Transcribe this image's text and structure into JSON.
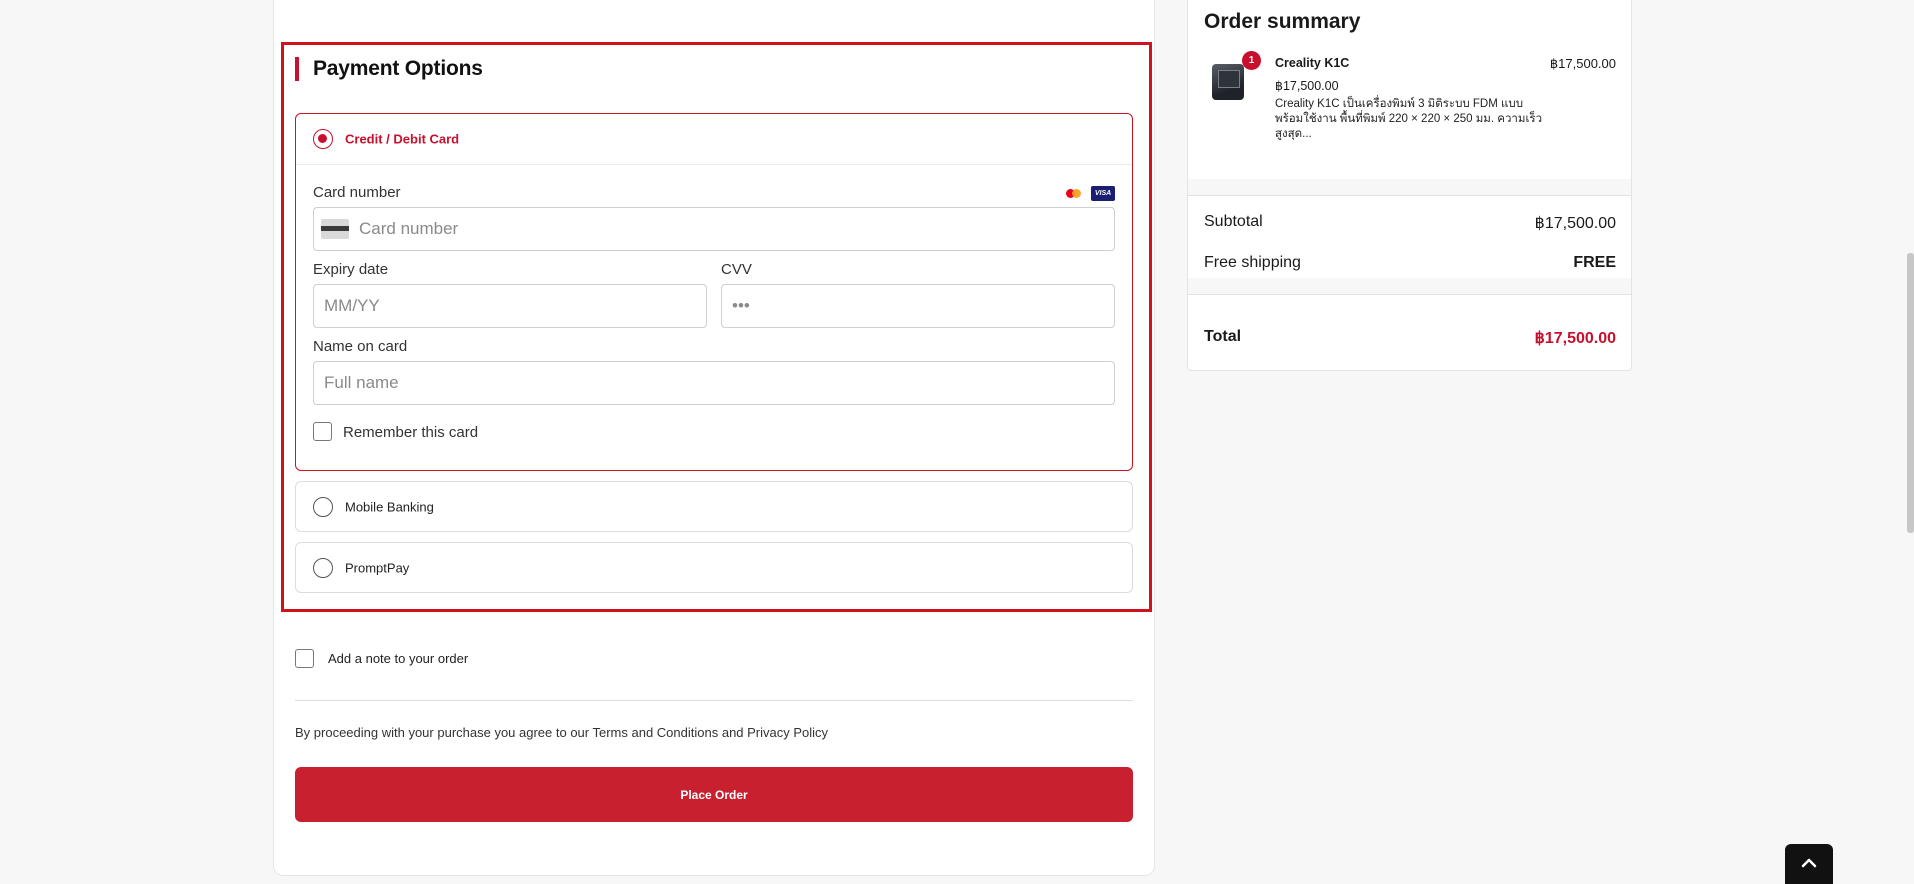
{
  "payment": {
    "heading": "Payment Options",
    "options": {
      "card": {
        "label": "Credit / Debit Card",
        "selected": true
      },
      "mobile": {
        "label": "Mobile Banking",
        "selected": false
      },
      "promptpay": {
        "label": "PromptPay",
        "selected": false
      }
    },
    "card_form": {
      "card_number_label": "Card number",
      "card_number_placeholder": "Card number",
      "card_number_value": "",
      "brands": {
        "visa": "VISA"
      },
      "brand_icons": [
        "mastercard-icon",
        "visa-icon"
      ],
      "expiry_label": "Expiry date",
      "expiry_placeholder": "MM/YY",
      "cvv_label": "CVV",
      "cvv_placeholder": "•••",
      "name_label": "Name on card",
      "name_placeholder": "Full name",
      "remember_label": "Remember this card",
      "remember_checked": false
    }
  },
  "order_note": {
    "label": "Add a note to your order",
    "checked": false
  },
  "terms": {
    "text": "By proceeding with your purchase you agree to our Terms and Conditions and Privacy Policy"
  },
  "place_order": {
    "label": "Place Order"
  },
  "summary": {
    "title": "Order summary",
    "item": {
      "quantity": "1",
      "name": "Creality K1C",
      "unit_price": "฿17,500.00",
      "description": "Creality K1C เป็นเครื่องพิมพ์ 3 มิติระบบ FDM แบบพร้อมใช้งาน พื้นที่พิมพ์ 220 × 220 × 250 มม. ความเร็วสูงสุด...",
      "line_total": "฿17,500.00"
    },
    "subtotal_label": "Subtotal",
    "subtotal_value": "฿17,500.00",
    "shipping_label": "Free shipping",
    "shipping_value": "FREE",
    "total_label": "Total",
    "total_value": "฿17,500.00"
  },
  "icons": {
    "back_to_top": "chevron-up-icon",
    "card_placeholder": "credit-card-icon"
  },
  "colors": {
    "accent": "#c8102e",
    "highlight_border": "#d0121f",
    "button": "#c8202f"
  }
}
